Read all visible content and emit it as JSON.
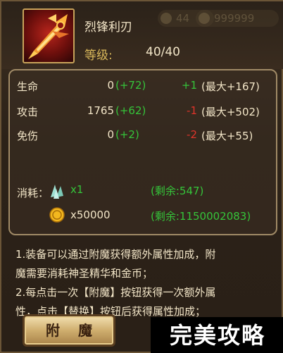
{
  "item": {
    "name": "烈锋利刃",
    "level_label": "等级:",
    "level_value": "40/40"
  },
  "header_faded": {
    "left_value": "44",
    "right_value": "999999"
  },
  "stats": [
    {
      "name": "生命",
      "base": "0",
      "bonus": "(+72)",
      "delta": "+1",
      "delta_sign": "positive",
      "max": "(最大+167)"
    },
    {
      "name": "攻击",
      "base": "1765",
      "bonus": "(+62)",
      "delta": "-1",
      "delta_sign": "negative",
      "max": "(最大+502)"
    },
    {
      "name": "免伤",
      "base": "0",
      "bonus": "(+2)",
      "delta": "-2",
      "delta_sign": "negative",
      "max": "(最大+55)"
    }
  ],
  "cost": {
    "label": "消耗：",
    "crystal_qty": "x1",
    "crystal_remaining": "(剩余:547)",
    "gold_qty": "x50000",
    "gold_remaining": "(剩余:1150002083)"
  },
  "notes": {
    "line1": "1.装备可以通过附魔获得额外属性加成，附",
    "line2": "魔需要消耗神圣精华和金币；",
    "line3": "2.每点击一次【附魔】按钮获得一次额外属",
    "line4": "性，点击【替换】按钮后获得属性加成；"
  },
  "buttons": {
    "enchant": "附魔"
  },
  "watermark": "完美攻略",
  "colors": {
    "positive": "#35c43a",
    "negative": "#e0342a",
    "gold_text": "#d8b75a",
    "main_text": "#f3e6c8"
  }
}
